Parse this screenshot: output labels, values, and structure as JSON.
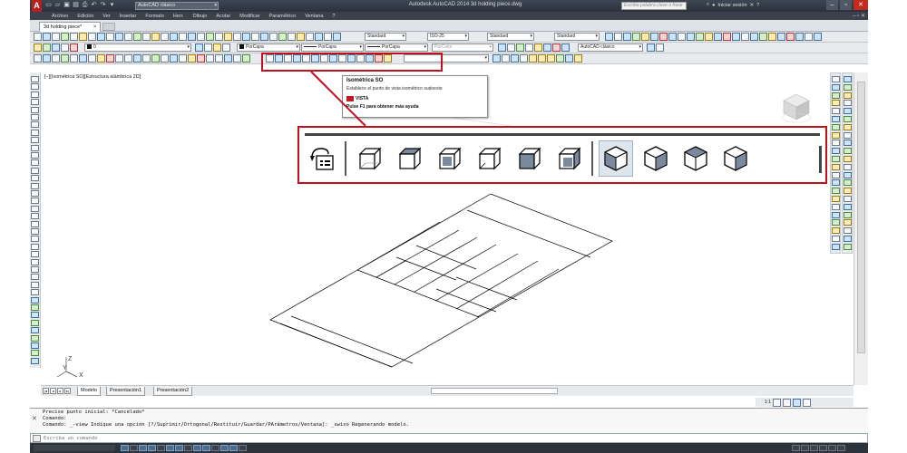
{
  "app": {
    "logo": "A",
    "title": "Autodesk AutoCAD 2014   3d holding piece.dwg"
  },
  "workspace": {
    "value": "AutoCAD clásico"
  },
  "search": {
    "placeholder": "Escriba palabra clave o frase"
  },
  "signin": {
    "label": "Iniciar sesión"
  },
  "menu": [
    "Archivo",
    "Edición",
    "Ver",
    "Insertar",
    "Formato",
    "Herr.",
    "Dibujo",
    "Acotar",
    "Modificar",
    "Paramétrico",
    "Ventana",
    "?"
  ],
  "menu_right": "– ▫ ✕",
  "document_tab": {
    "label": "3d holding piece*",
    "close": "✕"
  },
  "toolbar1": {
    "text_style": "Standard",
    "dim_style": "ISO-25",
    "table_style": "Standard",
    "mleader_style": "Standard"
  },
  "toolbar2": {
    "layer": "0",
    "color": "PorCapa",
    "linetype": "PorCapa",
    "lineweight": "PorCapa",
    "plotstyle": "PorColor",
    "workspace2": "AutoCAD clásico"
  },
  "viewport_label": "[−][Isométrica SO][Estructura alámbrica 2D]",
  "tooltip": {
    "title": "Isométrica SO",
    "description": "Establece el punto de vista isométrico sudoeste",
    "command": "VISTA",
    "help": "Pulse F1 para obtener más ayuda"
  },
  "ucs": {
    "x": "X",
    "y": "Y",
    "z": "Z"
  },
  "layout_tabs": [
    "Modelo",
    "Presentación1",
    "Presentación2"
  ],
  "status_right": {
    "scale": "1:1"
  },
  "command_history": [
    "Precise punto inicial: *Cancelado*",
    "Comando:",
    "Comando: _-view Indique una opción [?/Suprimir/Ortogonal/Restituir/Guardar/PArámetros/Ventana]: _swiso Regenerando modelo."
  ],
  "command_line": {
    "placeholder": "Escriba un comando"
  }
}
